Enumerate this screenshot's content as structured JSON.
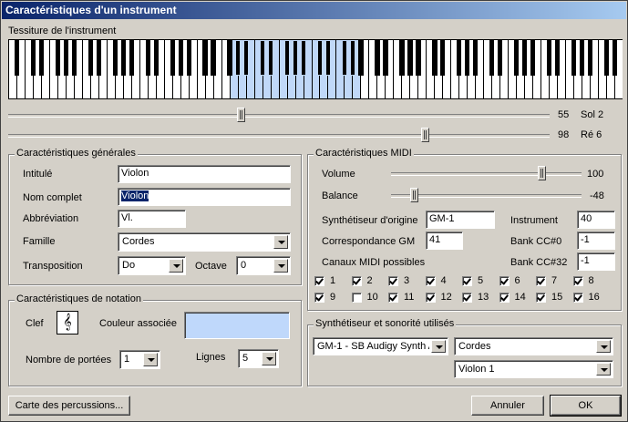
{
  "window": {
    "title": "Caractéristiques d'un instrument"
  },
  "tessiture": {
    "label": "Tessiture de l'instrument",
    "low": {
      "value": "55",
      "note": "Sol 2",
      "fraction": 0.43
    },
    "high": {
      "value": "98",
      "note": "Ré 6",
      "fraction": 0.77
    }
  },
  "general": {
    "title": "Caractéristiques générales",
    "intitule_label": "Intitulé",
    "intitule_value": "Violon",
    "nom_label": "Nom complet",
    "nom_value": "Violon",
    "abbr_label": "Abbréviation",
    "abbr_value": "Vl.",
    "famille_label": "Famille",
    "famille_value": "Cordes",
    "transposition_label": "Transposition",
    "transposition_value": "Do",
    "octave_label": "Octave",
    "octave_value": "0"
  },
  "notation": {
    "title": "Caractéristiques de notation",
    "clef_label": "Clef",
    "clef_glyph": "𝄞",
    "couleur_label": "Couleur associée",
    "couleur_value": "#bfd8fb",
    "portees_label": "Nombre de portées",
    "portees_value": "1",
    "lignes_label": "Lignes",
    "lignes_value": "5"
  },
  "midi": {
    "title": "Caractéristiques MIDI",
    "volume_label": "Volume",
    "volume_value": "100",
    "volume_fraction": 0.79,
    "balance_label": "Balance",
    "balance_value": "-48",
    "balance_fraction": 0.12,
    "synth_label": "Synthétiseur d'origine",
    "synth_value": "GM-1",
    "instrument_label": "Instrument",
    "instrument_value": "40",
    "gm_label": "Correspondance GM",
    "gm_value": "41",
    "cc0_label": "Bank CC#0",
    "cc0_value": "-1",
    "cc32_label": "Bank CC#32",
    "cc32_value": "-1",
    "channels_label": "Canaux MIDI possibles",
    "channels": [
      {
        "label": "1",
        "checked": true
      },
      {
        "label": "2",
        "checked": true
      },
      {
        "label": "3",
        "checked": true
      },
      {
        "label": "4",
        "checked": true
      },
      {
        "label": "5",
        "checked": true
      },
      {
        "label": "6",
        "checked": true
      },
      {
        "label": "7",
        "checked": true
      },
      {
        "label": "8",
        "checked": true
      },
      {
        "label": "9",
        "checked": true
      },
      {
        "label": "10",
        "checked": false
      },
      {
        "label": "11",
        "checked": true
      },
      {
        "label": "12",
        "checked": true
      },
      {
        "label": "13",
        "checked": true
      },
      {
        "label": "14",
        "checked": true
      },
      {
        "label": "15",
        "checked": true
      },
      {
        "label": "16",
        "checked": true
      }
    ]
  },
  "synth": {
    "title": "Synthétiseur et sonorité utilisés",
    "device_value": "GM-1 - SB Audigy Synth A",
    "family_value": "Cordes",
    "patch_value": "Violon 1"
  },
  "buttons": {
    "percussion": "Carte des percussions...",
    "cancel": "Annuler",
    "ok": "OK"
  }
}
